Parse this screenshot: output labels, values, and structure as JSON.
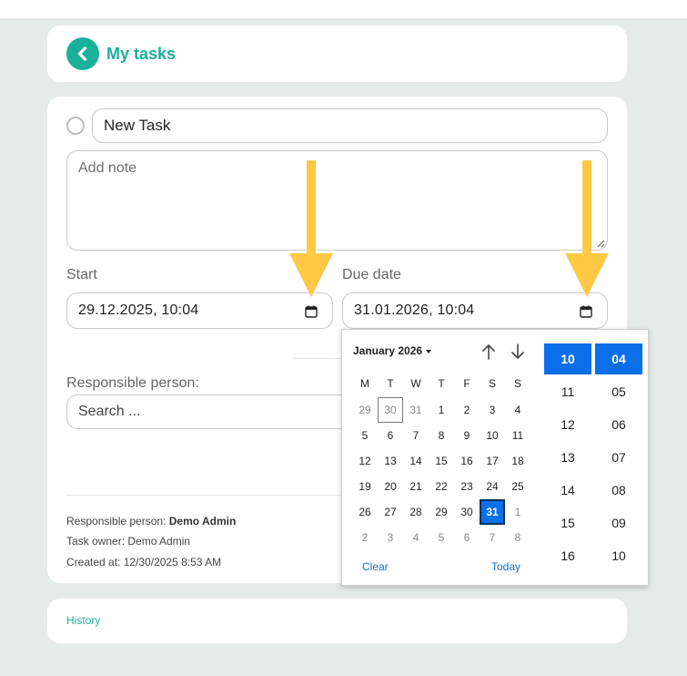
{
  "header": {
    "title": "My tasks"
  },
  "task": {
    "title_value": "New Task",
    "note_placeholder": "Add note",
    "start_label": "Start",
    "start_value": "29.12.2025, 10:04",
    "due_label": "Due date",
    "due_value": "31.01.2026, 10:04",
    "responsible_label": "Responsible person:",
    "search_placeholder": "Search ..."
  },
  "meta": {
    "responsible_prefix": "Responsible person: ",
    "responsible_name": "Demo Admin",
    "owner": "Task owner: Demo Admin",
    "created": "Created at: 12/30/2025 8:53 AM"
  },
  "history": {
    "label": "History"
  },
  "picker": {
    "month_label": "January 2026",
    "weekdays": [
      "M",
      "T",
      "W",
      "T",
      "F",
      "S",
      "S"
    ],
    "weeks": [
      [
        "29",
        "30",
        "31",
        "1",
        "2",
        "3",
        "4"
      ],
      [
        "5",
        "6",
        "7",
        "8",
        "9",
        "10",
        "11"
      ],
      [
        "12",
        "13",
        "14",
        "15",
        "16",
        "17",
        "18"
      ],
      [
        "19",
        "20",
        "21",
        "22",
        "23",
        "24",
        "25"
      ],
      [
        "26",
        "27",
        "28",
        "29",
        "30",
        "31",
        "1"
      ],
      [
        "2",
        "3",
        "4",
        "5",
        "6",
        "7",
        "8"
      ]
    ],
    "clear_label": "Clear",
    "today_label": "Today",
    "hours": [
      "10",
      "11",
      "12",
      "13",
      "14",
      "15",
      "16"
    ],
    "minutes": [
      "04",
      "05",
      "06",
      "07",
      "08",
      "09",
      "10"
    ],
    "selected_hour": "10",
    "selected_minute": "04"
  },
  "colors": {
    "accent": "#1ab09a",
    "selection": "#0a6fe8",
    "annotation_arrow": "#ffc845"
  },
  "icons": [
    "chevron-left-icon",
    "calendar-icon",
    "arrow-up-icon",
    "arrow-down-icon",
    "resize-grip-icon"
  ]
}
